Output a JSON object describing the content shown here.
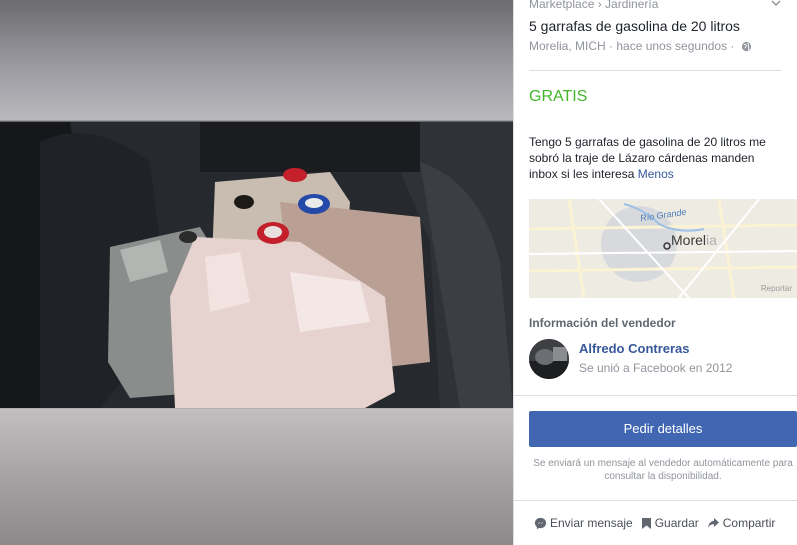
{
  "listing": {
    "breadcrumb": "Marketplace › Jardinería",
    "title": "5 garrafas de gasolina de 20 litros",
    "location_time": "Morelia, MICH · hace unos segundos ·",
    "price": "GRATIS",
    "description": "Tengo 5 garrafas de gasolina de 20 litros me sobró la traje de Lázaro cárdenas manden inbox si les interesa",
    "less_link": "Menos"
  },
  "map": {
    "city_main": "Morel",
    "city_faded": "ia",
    "river": "Río Grande",
    "report": "Reportar"
  },
  "seller": {
    "heading": "Información del vendedor",
    "name": "Alfredo Contreras",
    "since": "Se unió a Facebook en 2012"
  },
  "cta": {
    "button": "Pedir detalles",
    "note": "Se enviará un mensaje al vendedor automáticamente para consultar la disponibilidad."
  },
  "actions": {
    "message": "Enviar mensaje",
    "save": "Guardar",
    "share": "Compartir"
  },
  "colors": {
    "accent": "#4267b2",
    "price": "#42b72a",
    "link": "#365899"
  }
}
